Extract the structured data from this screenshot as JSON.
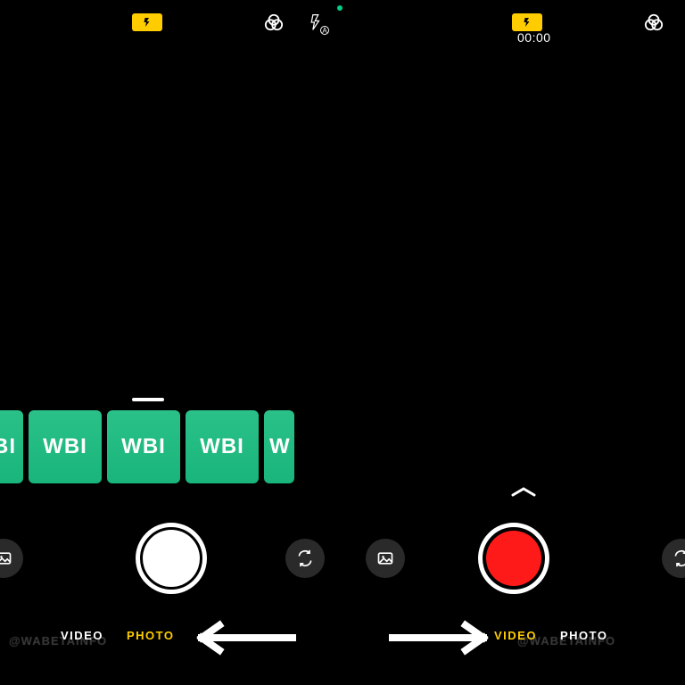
{
  "left": {
    "top": {
      "flash": "on",
      "filter": true,
      "flash_auto_badge": "A",
      "close": true
    },
    "gallery": {
      "handle": true,
      "items": [
        "BI",
        "WBI",
        "WBI",
        "WBI",
        "W"
      ]
    },
    "controls": {
      "left_button": "gallery",
      "shutter": "photo",
      "right_button": "switch"
    },
    "modes": {
      "video": "VIDEO",
      "photo": "PHOTO",
      "active": "photo"
    }
  },
  "right": {
    "top": {
      "flash": "on",
      "filter": true,
      "timer": "00:00"
    },
    "chevron": true,
    "controls": {
      "left_button": "gallery",
      "shutter": "video",
      "right_button": "switch"
    },
    "modes": {
      "video": "VIDEO",
      "photo": "PHOTO",
      "active": "video"
    }
  },
  "watermark": "@WABETAINFO",
  "colors": {
    "accent_yellow": "#ffcc00",
    "record_red": "#ff1a1a",
    "thumb_green": "#19b57c"
  }
}
